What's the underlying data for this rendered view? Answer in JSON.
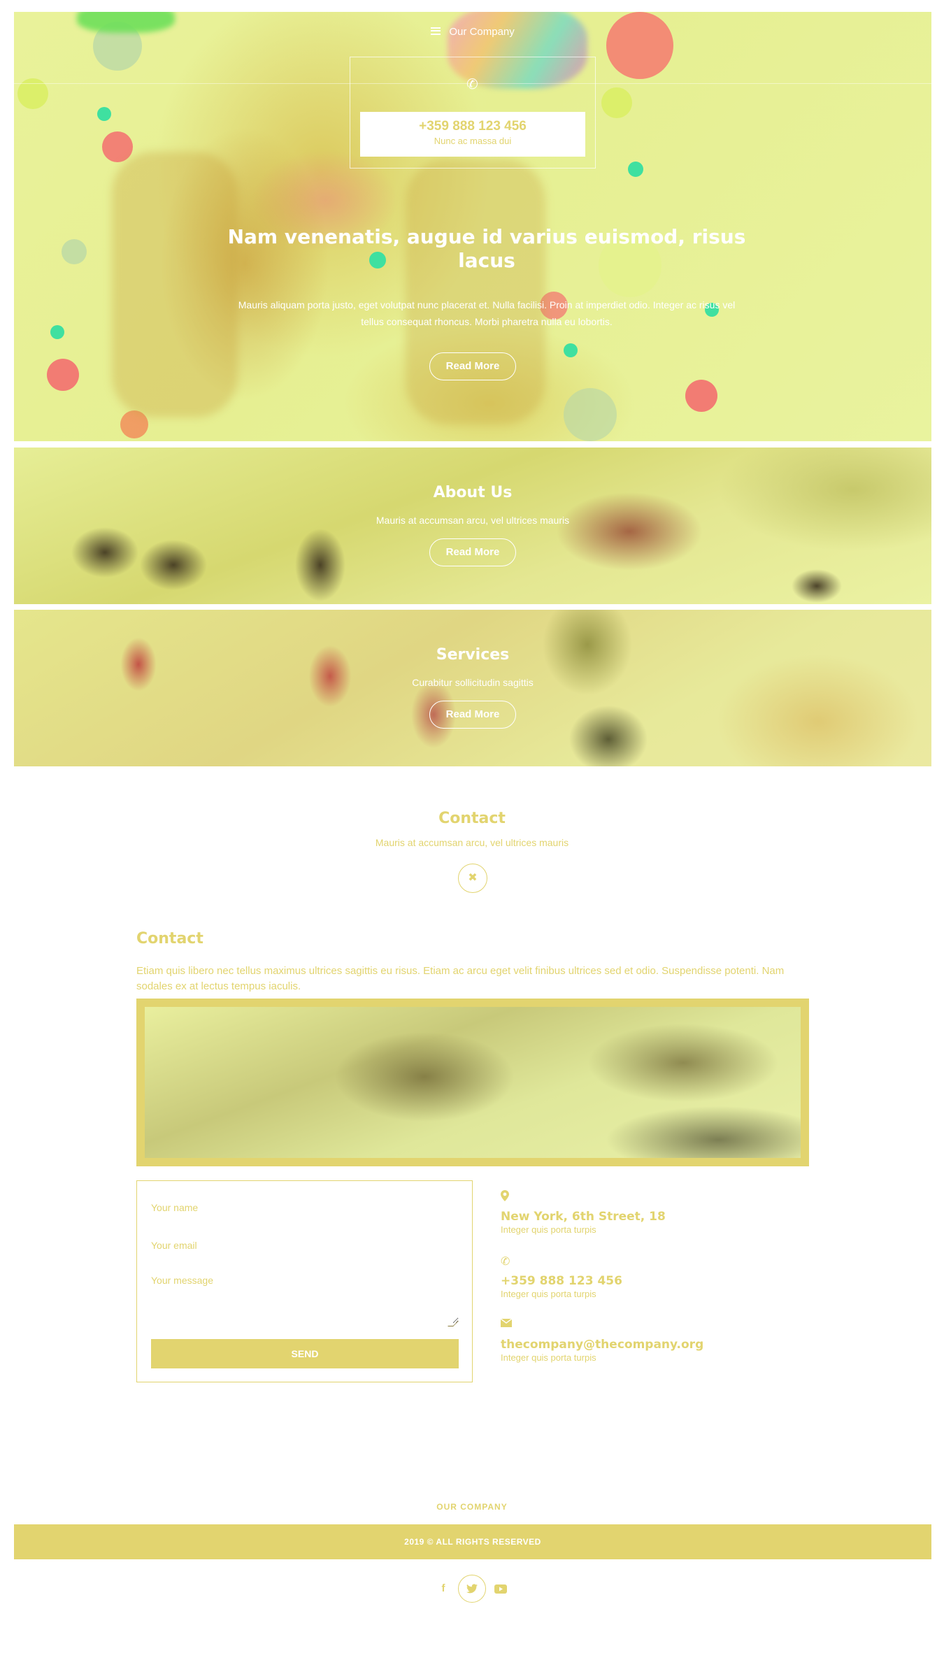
{
  "nav": {
    "brand": "Our Company",
    "menu_icon": "menu-icon"
  },
  "hero": {
    "phone": "+359 888 123 456",
    "phone_sub": "Nunc ac massa dui",
    "title": "Nam venenatis, augue id varius euismod, risus lacus",
    "text": "Mauris aliquam porta justo, eget volutpat nunc placerat et. Nulla facilisi. Proin at imperdiet odio. Integer ac risus vel tellus consequat rhoncus. Morbi pharetra nulla eu lobortis.",
    "button": "Read More"
  },
  "about": {
    "title": "About Us",
    "subtitle": "Mauris at accumsan arcu, vel ultrices mauris",
    "button": "Read More"
  },
  "services": {
    "title": "Services",
    "subtitle": "Curabitur sollicitudin sagittis",
    "button": "Read More"
  },
  "contact_header": {
    "title": "Contact",
    "subtitle": "Mauris at accumsan arcu, vel ultrices mauris",
    "close_symbol": "✖"
  },
  "contact": {
    "title": "Contact",
    "text": "Etiam quis libero nec tellus maximus ultrices sagittis eu risus. Etiam ac arcu eget velit finibus ultrices sed et odio. Suspendisse potenti. Nam sodales ex at lectus tempus iaculis.",
    "form": {
      "name_placeholder": "Your name",
      "email_placeholder": "Your email",
      "message_placeholder": "Your message",
      "send": "SEND"
    },
    "info": [
      {
        "icon": "map-marker-icon",
        "main": "New York, 6th Street, 18",
        "sub": "Integer quis porta turpis"
      },
      {
        "icon": "phone-icon",
        "main": "+359 888 123 456",
        "sub": "Integer quis porta turpis"
      },
      {
        "icon": "envelope-icon",
        "main": "thecompany@thecompany.org",
        "sub": "Integer quis porta turpis"
      }
    ]
  },
  "footer": {
    "brand": "OUR COMPANY",
    "copyright": "2019 © ALL RIGHTS RESERVED",
    "socials": [
      "facebook-icon",
      "twitter-icon",
      "youtube-icon"
    ]
  },
  "colors": {
    "accent": "#e2d46f",
    "overlay": "#e9f29a",
    "text_light": "#ffffff"
  }
}
